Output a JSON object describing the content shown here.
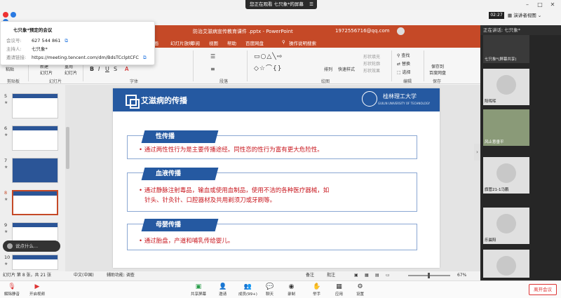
{
  "meeting": {
    "viewing_banner": "您正在观看  七只象*的屏幕",
    "clock": "02:27",
    "speaker_view_label": "演讲者视图",
    "speaking_label": "正在讲话:   七只象*",
    "info": {
      "title": "七只象*预定的会议",
      "id_label": "会议号:",
      "id_value": "627 544 861",
      "host_label": "主持人:",
      "host_value": "七只象*",
      "link_label": "邀请链接:",
      "link_value": "https://meeting.tencent.com/dm/BdsTCclptCFC"
    },
    "input_placeholder": "说点什么..."
  },
  "ppt": {
    "title": "防治艾滋病宣传教育课件 .pptx  -  PowerPoint",
    "account": "1972556716@qq.com",
    "tabs": [
      "动画",
      "幻灯片放映",
      "审阅",
      "视图",
      "帮助",
      "百度网盘",
      "操作说明搜索"
    ],
    "groups": [
      "剪贴板",
      "幻灯片",
      "字体",
      "段落",
      "绘图",
      "编辑",
      "保存"
    ],
    "ribbon": {
      "paste": "粘贴",
      "new_slide": "新建\n幻灯片",
      "reuse": "重用\n幻灯片",
      "arrange": "排列",
      "quick_styles": "快速样式",
      "fill": "形状填充",
      "outline": "形状轮廓",
      "effects": "形状效果",
      "find": "查找",
      "replace": "替换",
      "select": "选择",
      "save_baidu": "保存到\n百度网盘"
    },
    "statusbar": {
      "slide_of": "幻灯片 第 8 张，共 21 张",
      "lang": "中文(中国)",
      "accessibility": "辅助功能: 调查",
      "notes": "备注",
      "comments": "批注",
      "zoom": "67%"
    },
    "thumbs": [
      {
        "num": "5",
        "star": "★"
      },
      {
        "num": "6",
        "star": "★"
      },
      {
        "num": "7",
        "star": "★"
      },
      {
        "num": "8",
        "star": "★"
      },
      {
        "num": "9",
        "star": "★"
      },
      {
        "num": "10",
        "star": "★"
      }
    ]
  },
  "slide": {
    "title": "艾滋病的传播",
    "university_cn": "桂林理工大学",
    "university_en": "GUILIN UNIVERSITY OF TECHNOLOGY",
    "sections": [
      {
        "label": "性传播",
        "text": "• 通过两性性行为是主要传播途经。同性恋的性行为富有更大危险性。"
      },
      {
        "label": "血液传播",
        "text": "• 通过静脉注射毒品，输血或使用血制品，使用不洁的各种医疗器械，如\n   针头、针灸针、口腔器材及共用剃须刀或牙刷等。"
      },
      {
        "label": "母婴传播",
        "text": "• 通过胎盘，产道和哺乳传给婴儿。"
      }
    ]
  },
  "participants": [
    {
      "name": "七只象*(屏幕共享)"
    },
    {
      "name": "阳晖晖"
    },
    {
      "name": "风止意垂平"
    },
    {
      "name": "旗管21-1马鹏"
    },
    {
      "name": "乐晨阳"
    }
  ],
  "toolbar": {
    "mute": "解除静音",
    "video": "开启视频",
    "share": "共享屏幕",
    "invite": "邀请",
    "members": "成员(99+)",
    "chat": "聊天",
    "record": "录制",
    "raise": "举手",
    "apps": "应用",
    "settings": "设置",
    "leave": "离开会议"
  },
  "colors": {
    "ppt_red": "#c54927",
    "slide_blue": "#2559a1",
    "slide_text_red": "#c8161d"
  }
}
